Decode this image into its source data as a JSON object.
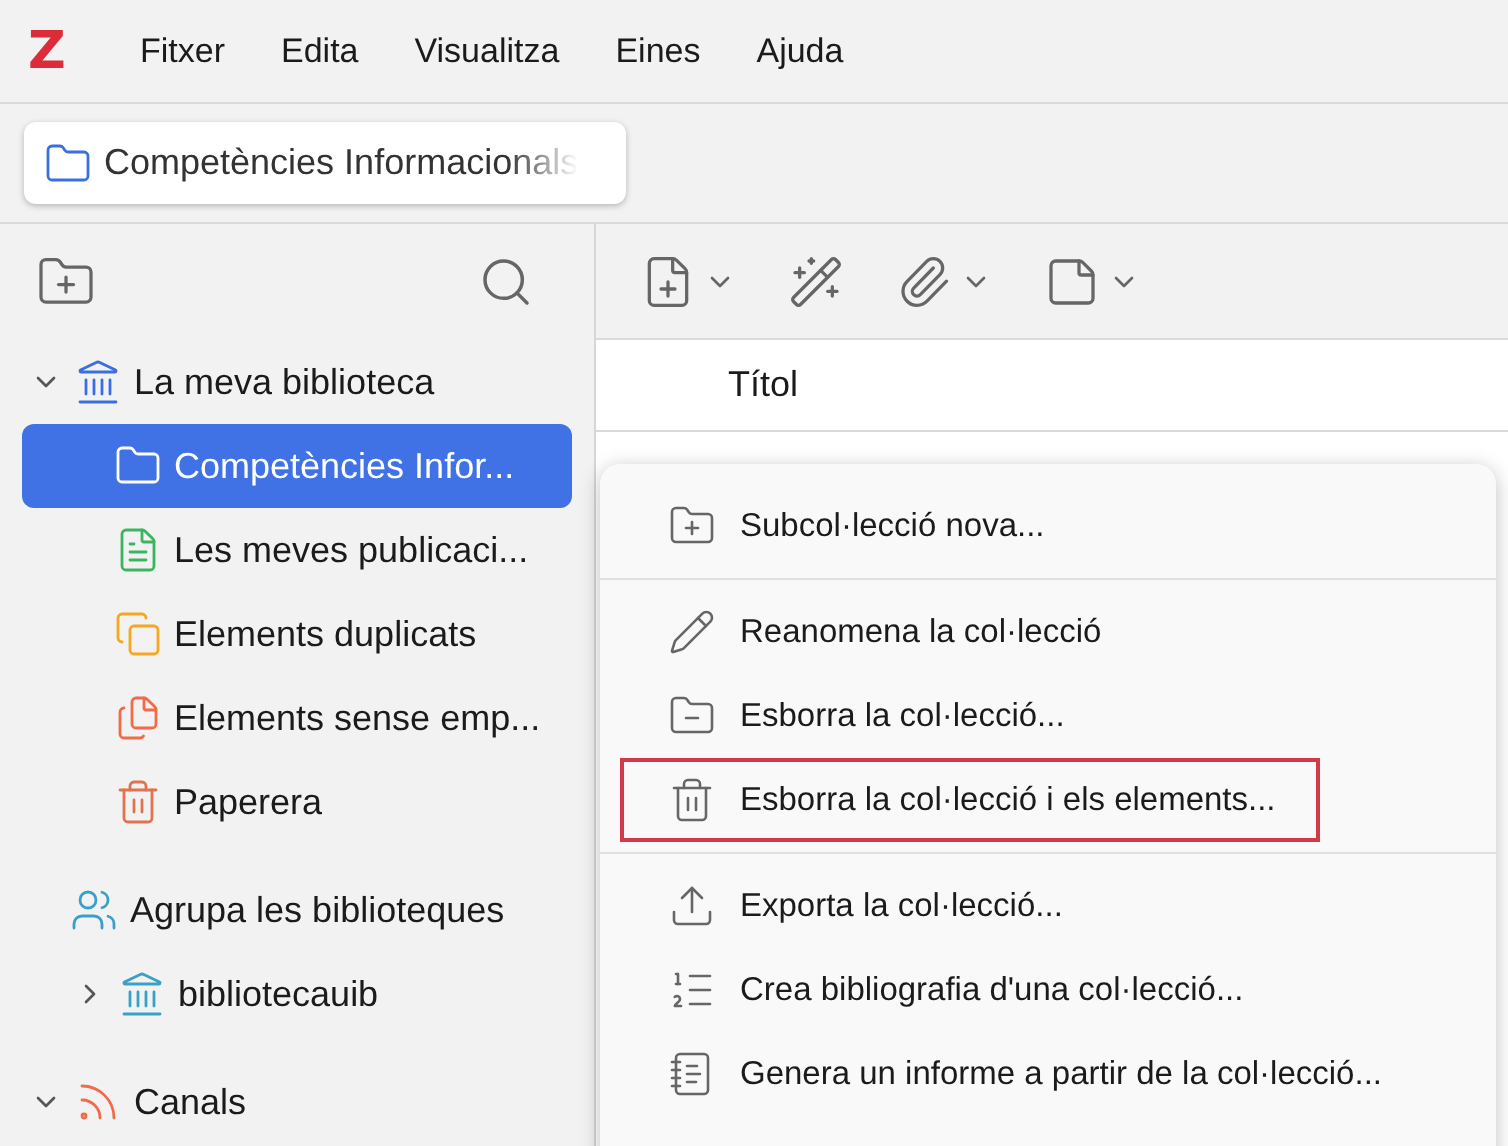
{
  "app": {
    "logo": "Z"
  },
  "menubar": [
    "Fitxer",
    "Edita",
    "Visualitza",
    "Eines",
    "Ajuda"
  ],
  "tabs": [
    {
      "label": "Competències Informacionals",
      "selected": true
    }
  ],
  "sidebar": {
    "tree": [
      {
        "label": "La meva biblioteca",
        "kind": "library",
        "selected": false,
        "expanded": true,
        "children": [
          {
            "label": "Competències Infor...",
            "kind": "collection",
            "selected": true
          },
          {
            "label": "Les meves publicaci...",
            "kind": "publications",
            "selected": false
          },
          {
            "label": "Elements duplicats",
            "kind": "duplicates",
            "selected": false
          },
          {
            "label": "Elements sense emp...",
            "kind": "unfiled",
            "selected": false
          },
          {
            "label": "Paperera",
            "kind": "trash",
            "selected": false
          }
        ]
      },
      {
        "label": "Agrupa les biblioteques",
        "kind": "groups",
        "selected": false
      },
      {
        "label": "bibliotecauib",
        "kind": "group",
        "selected": false,
        "expanded": false
      },
      {
        "label": "Canals",
        "kind": "feeds",
        "selected": false,
        "expanded": true
      }
    ]
  },
  "toolbar": [
    {
      "kind": "new-item",
      "dropdown": true
    },
    {
      "kind": "magic",
      "dropdown": false
    },
    {
      "kind": "attachment",
      "dropdown": true
    },
    {
      "kind": "note",
      "dropdown": true
    }
  ],
  "table": {
    "columns": [
      "Títol"
    ]
  },
  "context_menu": [
    {
      "kind": "subcollection",
      "label": "Subcol·lecció nova..."
    },
    {
      "kind": "separator"
    },
    {
      "kind": "rename",
      "label": "Reanomena la col·lecció"
    },
    {
      "kind": "delete",
      "label": "Esborra la col·lecció..."
    },
    {
      "kind": "deleteall",
      "label": "Esborra la col·lecció i els elements...",
      "highlighted": true
    },
    {
      "kind": "separator"
    },
    {
      "kind": "export",
      "label": "Exporta la col·lecció..."
    },
    {
      "kind": "bibliography",
      "label": "Crea bibliografia d'una col·lecció..."
    },
    {
      "kind": "report",
      "label": "Genera un informe a partir de la col·lecció..."
    }
  ]
}
